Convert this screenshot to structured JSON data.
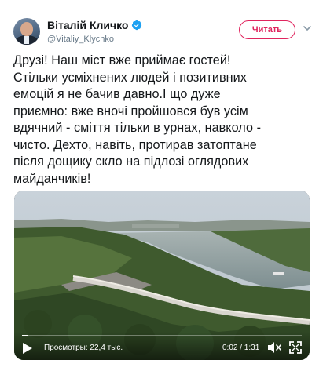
{
  "author": {
    "display_name": "Віталій Кличко",
    "handle": "@Vitaliy_Klychko",
    "verified": true
  },
  "actions": {
    "read_label": "Читать"
  },
  "tweet": {
    "text": "Друзі! Наш міст вже приймає гостей!\nСтільки усміхнених людей і позитивних\nемоцій я не бачив давно.І що дуже\nприємно: вже вночі пройшовся був усім\nвдячний - сміття тільки в урнах, навколо -\nчисто. Дехто, навіть, протирав затоптане\nпісля дощику скло на підлозі оглядових\nмайданчиків!"
  },
  "video": {
    "views_label": "Просмотры: 22,4 тыс.",
    "time_label": "0:02 / 1:31",
    "progress": 0.022
  },
  "colors": {
    "accent": "#e0245e",
    "verified": "#1da1f2",
    "muted_text": "#657786"
  },
  "icons": [
    "verified-badge-icon",
    "chevron-down-icon",
    "play-icon",
    "volume-muted-icon",
    "fullscreen-icon"
  ]
}
